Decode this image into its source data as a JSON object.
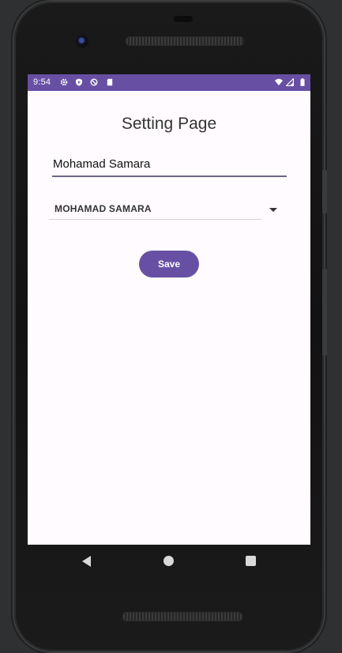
{
  "status_bar": {
    "time": "9:54",
    "icons_left": [
      "settings-icon",
      "shield-play-icon",
      "no-sync-icon",
      "sd-card-icon"
    ],
    "icons_right": [
      "wifi-icon",
      "signal-icon",
      "battery-icon"
    ],
    "color": "#6750a4"
  },
  "page": {
    "title": "Setting Page",
    "name_input": {
      "value": "Mohamad Samara"
    },
    "dropdown": {
      "selected": "MOHAMAD SAMARA"
    },
    "save_label": "Save"
  },
  "navigation": {
    "buttons": [
      "back-icon",
      "home-icon",
      "recents-icon"
    ]
  },
  "colors": {
    "accent": "#6750a4",
    "screen_bg": "#fffbfe"
  }
}
